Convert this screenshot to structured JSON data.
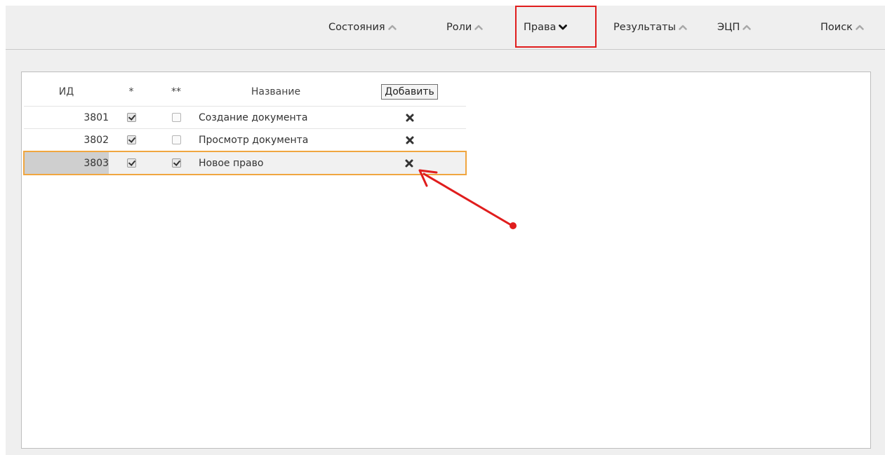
{
  "tabs": [
    {
      "label": "Состояния",
      "state": "collapsed"
    },
    {
      "label": "Роли",
      "state": "collapsed"
    },
    {
      "label": "Права",
      "state": "expanded"
    },
    {
      "label": "Результаты",
      "state": "collapsed"
    },
    {
      "label": "ЭЦП",
      "state": "collapsed"
    },
    {
      "label": "Поиск",
      "state": "collapsed"
    }
  ],
  "table": {
    "headers": {
      "id": "ИД",
      "flag1": "*",
      "flag2": "**",
      "name": "Название",
      "add_button": "Добавить"
    },
    "rows": [
      {
        "id": "3801",
        "flag1": true,
        "flag2": false,
        "name": "Создание документа",
        "selected": false
      },
      {
        "id": "3802",
        "flag1": true,
        "flag2": false,
        "name": "Просмотр документа",
        "selected": false
      },
      {
        "id": "3803",
        "flag1": true,
        "flag2": true,
        "name": "Новое право",
        "selected": true
      }
    ],
    "delete_icon": "close-x-icon"
  },
  "colors": {
    "active_tab_outline": "#e01d1d",
    "selected_row_outline": "#f0a640",
    "annotation_arrow": "#e01d1d"
  }
}
